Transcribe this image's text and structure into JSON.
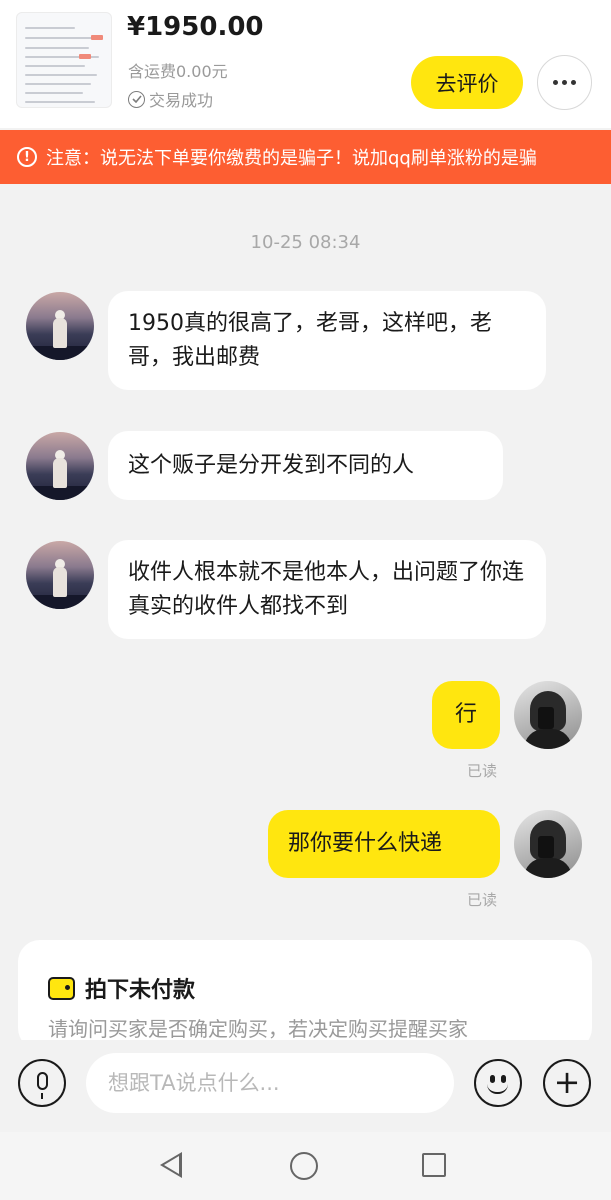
{
  "header": {
    "price": "¥1950.00",
    "shipping": "含运费0.00元",
    "status": "交易成功",
    "review_button": "去评价"
  },
  "notice": {
    "text": "注意：说无法下单要你缴费的是骗子！说加qq刷单涨粉的是骗"
  },
  "chat": {
    "timestamp": "10-25 08:34",
    "messages": [
      {
        "from": "other",
        "text": "1950真的很高了，老哥，这样吧，老哥，我出邮费"
      },
      {
        "from": "other",
        "text": "这个贩子是分开发到不同的人"
      },
      {
        "from": "other",
        "text": "收件人根本就不是他本人，出问题了你连真实的收件人都找不到"
      },
      {
        "from": "me",
        "text": "行",
        "read": "已读"
      },
      {
        "from": "me",
        "text": "那你要什么快递",
        "read": "已读"
      }
    ]
  },
  "card": {
    "title": "拍下未付款",
    "description": "请询问买家是否确定购买，若决定购买提醒买家"
  },
  "input": {
    "placeholder": "想跟TA说点什么..."
  },
  "icons": {
    "status": "check-circle-icon",
    "more": "more-icon",
    "notice": "warning-icon",
    "card": "wallet-icon",
    "voice": "microphone-icon",
    "emoji": "emoji-icon",
    "add": "plus-icon"
  },
  "colors": {
    "accent": "#ffe60f",
    "notice_bg": "#fd5e32",
    "background": "#f2f2f2"
  }
}
